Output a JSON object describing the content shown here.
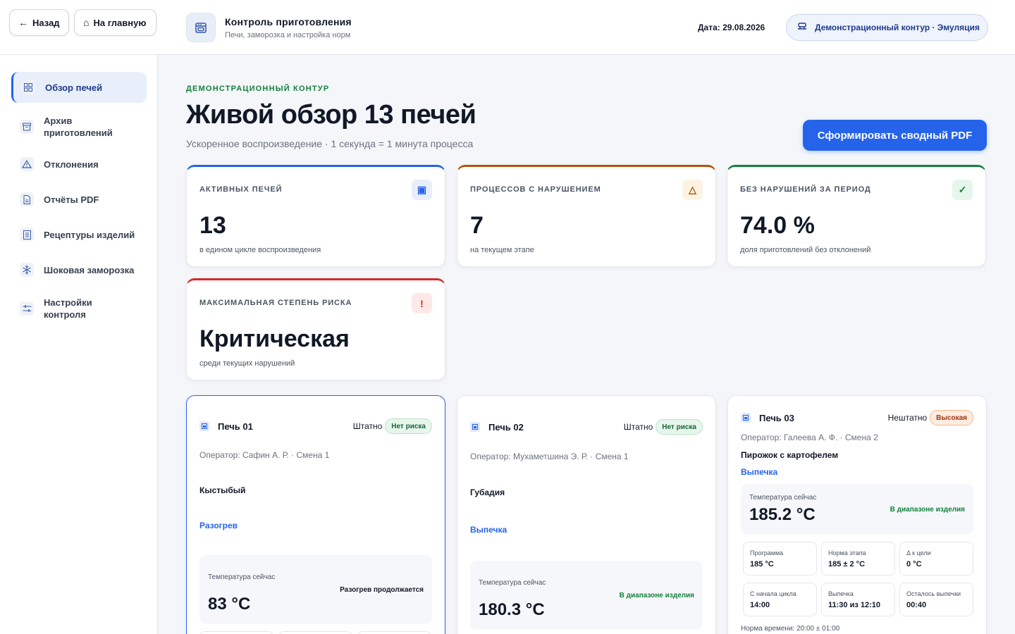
{
  "header": {
    "back_label": "Назад",
    "home_label": "На главную",
    "app_title": "Контроль приготовления",
    "app_subtitle": "Печи, заморозка и настройка норм",
    "date": "Дата: 29.08.2026",
    "mode": "Демонстрационный контур · Эмуляция"
  },
  "sidebar": {
    "items": [
      {
        "label": "Обзор печей",
        "icon": "grid-icon",
        "active": true
      },
      {
        "label": "Архив приготовлений",
        "icon": "archive-icon"
      },
      {
        "label": "Отклонения",
        "icon": "warning-icon"
      },
      {
        "label": "Отчёты PDF",
        "icon": "document-icon"
      },
      {
        "label": "Рецептуры изделий",
        "icon": "recipe-icon"
      },
      {
        "label": "Шоковая заморозка",
        "icon": "snowflake-icon"
      },
      {
        "label": "Настройки контроля",
        "icon": "sliders-icon"
      }
    ]
  },
  "main": {
    "eyebrow": "ДЕМОНСТРАЦИОННЫЙ КОНТУР",
    "title": "Живой обзор 13 печей",
    "subtitle": "Ускоренное воспроизведение · 1 секунда = 1 минута процесса",
    "pdf_button": "Сформировать сводный PDF"
  },
  "stats": [
    {
      "label": "АКТИВНЫХ ПЕЧЕЙ",
      "value": "13",
      "note": "в едином цикле воспроизведения",
      "badge": "▣",
      "color": "#2563eb"
    },
    {
      "label": "ПРОЦЕССОВ С НАРУШЕНИЕМ",
      "value": "7",
      "note": "на текущем этапе",
      "badge": "△",
      "color": "#b45309"
    },
    {
      "label": "БЕЗ НАРУШЕНИЙ ЗА ПЕРИОД",
      "value": "74.0 %",
      "note": "доля приготовлений без отклонений",
      "badge": "✓",
      "color": "#15803d"
    },
    {
      "label": "МАКСИМАЛЬНАЯ СТЕПЕНЬ РИСКА",
      "value": "Критическая",
      "note": "среди текущих нарушений",
      "badge": "!",
      "color": "#dc2626"
    }
  ],
  "ovens": [
    {
      "name": "Печь 01",
      "status": "Штатно",
      "risk": "Нет риска",
      "operator": "Оператор: Сафин А. Р. · Смена 1",
      "product": "Кыстыбый",
      "stage": "Разогрев",
      "temp_label": "Температура сейчас",
      "temp": "83 °C",
      "temp_note": "Разогрев продолжается",
      "temp_note_color": "#111827"
    },
    {
      "name": "Печь 02",
      "status": "Штатно",
      "risk": "Нет риска",
      "operator": "Оператор: Мухаметшина Э. Р. · Смена 1",
      "product": "Губадия",
      "stage": "Выпечка",
      "temp_label": "Температура сейчас",
      "temp": "180.3 °C",
      "temp_note": "В диапазоне изделия",
      "temp_note_color": "#15803d"
    },
    {
      "name": "Печь 03",
      "status": "Нештатно",
      "risk": "Высокая",
      "operator": "Оператор: Галеева А. Ф. · Смена 2",
      "product": "Пирожок с картофелем",
      "stage": "Выпечка",
      "temp_label": "Температура сейчас",
      "temp": "185.2 °C",
      "temp_note": "В диапазоне изделия",
      "temp_note_color": "#15803d",
      "params": [
        {
          "label": "Программа",
          "value": "185 °C"
        },
        {
          "label": "Норма этапа",
          "value": "185 ± 2 °C"
        },
        {
          "label": "Δ к цели",
          "value": "0 °C"
        },
        {
          "label": "С начала цикла",
          "value": "14:00"
        },
        {
          "label": "Выпечка",
          "value": "11:30 из 12:10"
        },
        {
          "label": "Осталось выпечки",
          "value": "00:40"
        }
      ],
      "norm_time": "Норма времени: 20:00 ± 01:00"
    }
  ]
}
